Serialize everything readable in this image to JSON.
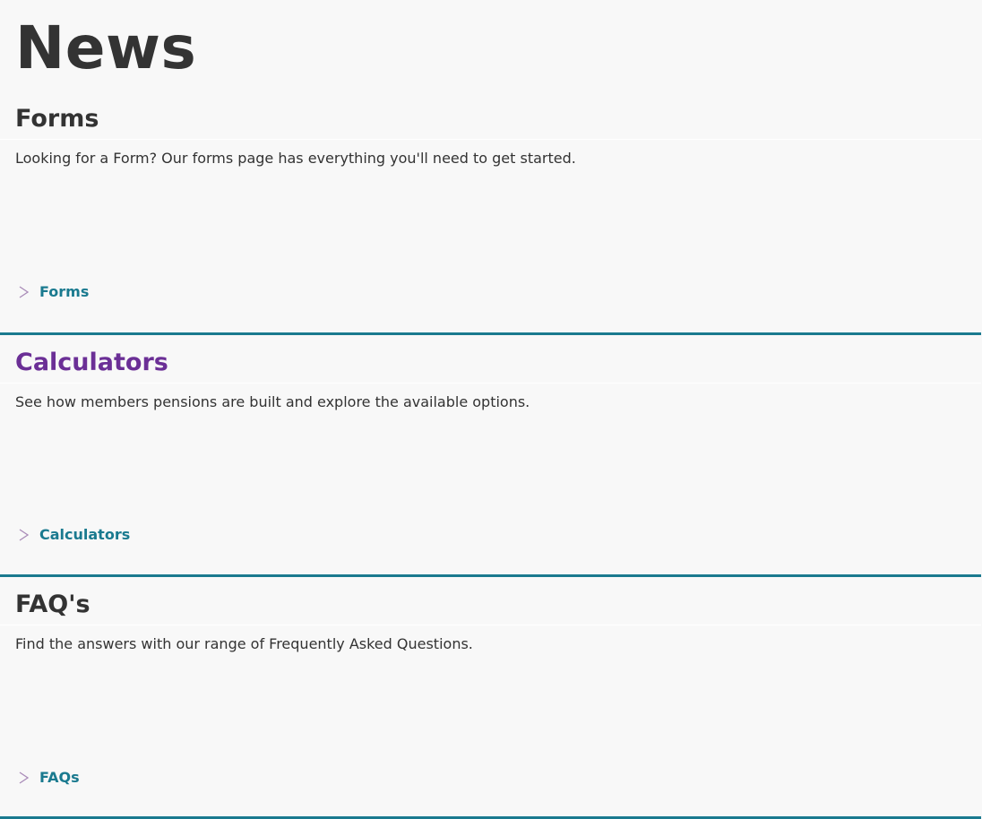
{
  "page": {
    "title": "News"
  },
  "cards": [
    {
      "title": "Forms",
      "description": "Looking for a Form? Our forms page has everything you'll need to get started.",
      "link_label": "Forms",
      "link_icon": "chevron-right-icon"
    },
    {
      "title": "Calculators",
      "description": "See how members pensions are built and explore the available options.",
      "link_label": "Calculators",
      "link_icon": "chevron-right-icon"
    },
    {
      "title": "FAQ's",
      "description": "Find the answers with our range of Frequently Asked Questions.",
      "link_label": "FAQs",
      "link_icon": "chevron-right-icon"
    }
  ],
  "colors": {
    "accent": "#1a7a8f",
    "visited_title": "#6b2f96",
    "text": "#333333",
    "background": "#f8f8f8"
  }
}
